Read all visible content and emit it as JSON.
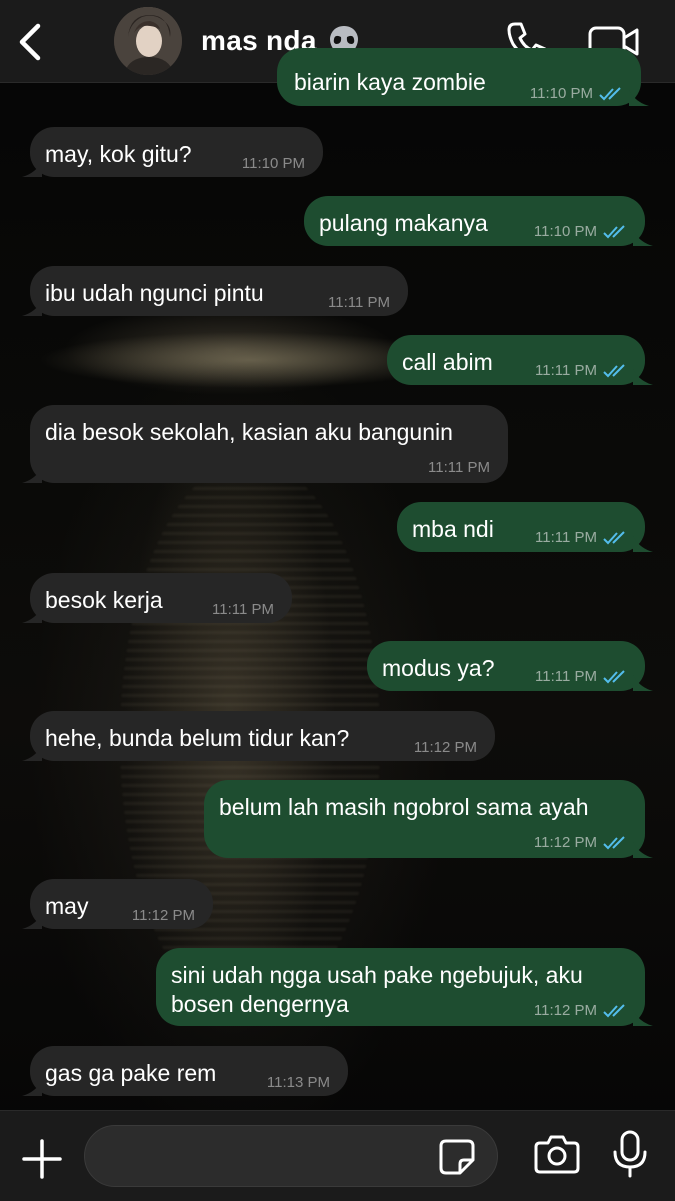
{
  "header": {
    "back_icon": "chevron-left-icon",
    "contact_name": "mas nda",
    "contact_emoji": "alien-icon",
    "call_icon": "phone-icon",
    "video_icon": "video-camera-icon"
  },
  "messages": [
    {
      "dir": "out",
      "text": "biarin kaya zombie",
      "time": "11:10 PM",
      "read": true
    },
    {
      "dir": "in",
      "text": "may, kok gitu?",
      "time": "11:10 PM"
    },
    {
      "dir": "out",
      "text": "pulang makanya",
      "time": "11:10 PM",
      "read": true
    },
    {
      "dir": "in",
      "text": "ibu udah ngunci pintu",
      "time": "11:11 PM"
    },
    {
      "dir": "out",
      "text": "call abim",
      "time": "11:11 PM",
      "read": true
    },
    {
      "dir": "in",
      "text": "dia besok sekolah, kasian aku bangunin",
      "time": "11:11 PM"
    },
    {
      "dir": "out",
      "text": "mba ndi",
      "time": "11:11 PM",
      "read": true
    },
    {
      "dir": "in",
      "text": "besok kerja",
      "time": "11:11 PM"
    },
    {
      "dir": "out",
      "text": "modus ya?",
      "time": "11:11 PM",
      "read": true
    },
    {
      "dir": "in",
      "text": "hehe, bunda belum tidur kan?",
      "time": "11:12 PM"
    },
    {
      "dir": "out",
      "text": "belum lah masih ngobrol sama ayah",
      "time": "11:12 PM",
      "read": true
    },
    {
      "dir": "in",
      "text": "may",
      "time": "11:12 PM"
    },
    {
      "dir": "out",
      "text": "sini udah ngga usah pake ngebujuk, aku bosen dengernya",
      "time": "11:12 PM",
      "read": true
    },
    {
      "dir": "in",
      "text": "gas ga pake rem",
      "time": "11:13 PM"
    }
  ],
  "footer": {
    "plus_icon": "plus-icon",
    "input_placeholder": "",
    "sticker_icon": "sticker-icon",
    "camera_icon": "camera-icon",
    "mic_icon": "microphone-icon"
  },
  "colors": {
    "outgoing_bubble": "#1e4d30",
    "incoming_bubble": "#262626",
    "read_tick": "#53bdeb",
    "bar_background": "#1b1b1b"
  }
}
